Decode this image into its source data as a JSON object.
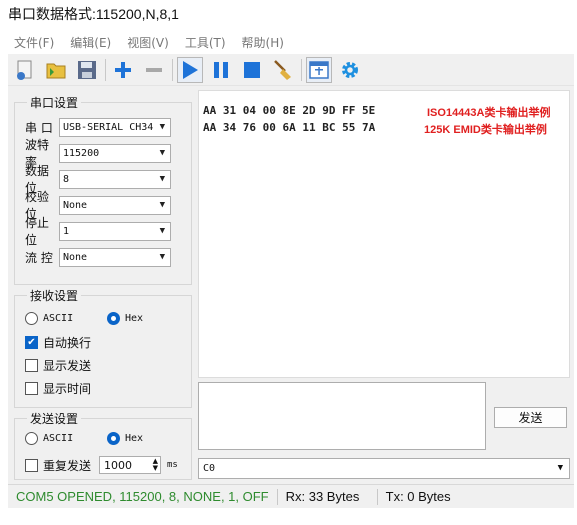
{
  "caption": "串口数据格式:115200,N,8,1",
  "menu": [
    "文件(F)",
    "编辑(E)",
    "视图(V)",
    "工具(T)",
    "帮助(H)"
  ],
  "toolbar_icons": [
    "new-file-icon",
    "open-file-icon",
    "save-icon",
    "plus-icon",
    "minus-icon",
    "play-icon",
    "pause-icon",
    "stop-icon",
    "broom-icon",
    "window-icon",
    "gear-icon"
  ],
  "serial": {
    "title": "串口设置",
    "fields": [
      {
        "label": "串  口",
        "value": "USB-SERIAL CH34"
      },
      {
        "label": "波特率",
        "value": "115200"
      },
      {
        "label": "数据位",
        "value": "8"
      },
      {
        "label": "校验位",
        "value": "None"
      },
      {
        "label": "停止位",
        "value": "1"
      },
      {
        "label": "流  控",
        "value": "None"
      }
    ]
  },
  "receive": {
    "title": "接收设置",
    "ascii": "ASCII",
    "hex": "Hex",
    "auto_newline": "自动换行",
    "show_send": "显示发送",
    "show_time": "显示时间"
  },
  "send": {
    "title": "发送设置",
    "ascii": "ASCII",
    "hex": "Hex",
    "repeat": "重复发送",
    "interval": "1000",
    "unit": "ms",
    "button": "发送"
  },
  "rx_lines": [
    {
      "hex": "AA 31 04 00 8E 2D 9D FF 5E",
      "note": "ISO14443A类卡输出举例"
    },
    {
      "hex": "AA 34 76 00 6A 11 BC 55 7A",
      "note": "125K EMID类卡输出举例"
    }
  ],
  "bottom_combo": "C0",
  "status": {
    "port": "COM5 OPENED, 115200, 8, NONE, 1, OFF",
    "rx": "Rx: 33 Bytes",
    "tx": "Tx: 0 Bytes"
  },
  "colors": {
    "status_green": "#2e8b2e",
    "note_red": "#e02020",
    "accent_blue": "#0a64c8"
  }
}
